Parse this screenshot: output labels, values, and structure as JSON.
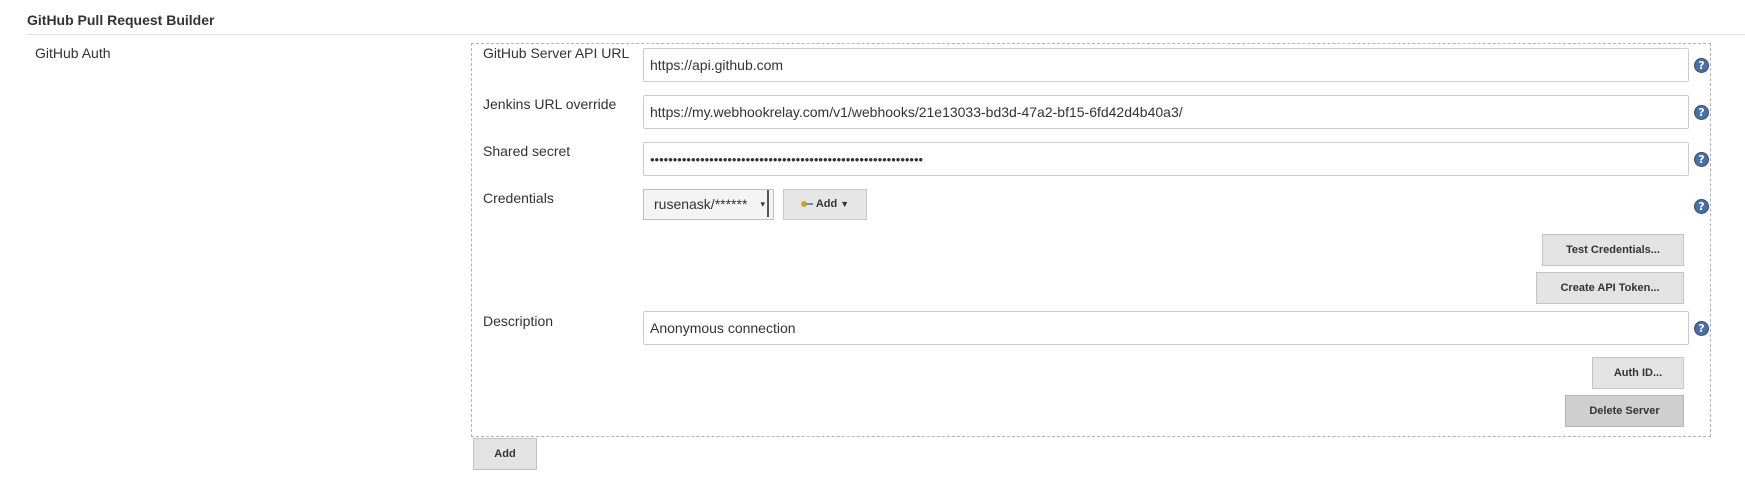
{
  "section": {
    "title": "GitHub Pull Request Builder"
  },
  "auth": {
    "label": "GitHub Auth"
  },
  "fields": {
    "server_api_url": {
      "label": "GitHub Server API URL",
      "value": "https://api.github.com"
    },
    "jenkins_url_override": {
      "label": "Jenkins URL override",
      "value": "https://my.webhookrelay.com/v1/webhooks/21e13033-bd3d-47a2-bf15-6fd42d4b40a3/"
    },
    "shared_secret": {
      "label": "Shared secret",
      "value": "••••••••••••••••••••••••••••••••••••••••••••••••••••••••••••"
    },
    "credentials": {
      "label": "Credentials",
      "selected": "rusenask/******",
      "add_label": "Add"
    },
    "description": {
      "label": "Description",
      "value": "Anonymous connection"
    }
  },
  "buttons": {
    "test_credentials": "Test Credentials...",
    "create_api_token": "Create API Token...",
    "auth_id": "Auth ID...",
    "delete_server": "Delete Server",
    "add": "Add"
  },
  "icons": {
    "help": "help-icon",
    "key": "key-icon",
    "caret": "chevron-down-icon"
  },
  "colors": {
    "help_icon": "#4a6fa5",
    "button_bg": "#e3e3e3",
    "border": "#cccccc"
  }
}
